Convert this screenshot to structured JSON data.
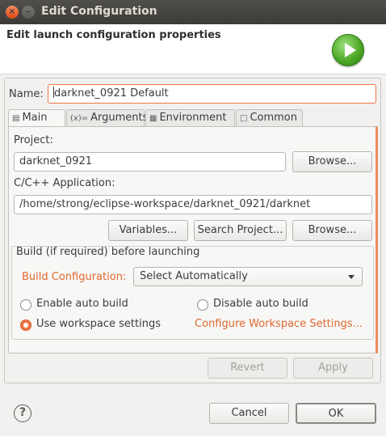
{
  "window": {
    "title": "Edit Configuration",
    "close_glyph": "×",
    "minimize_glyph": "–"
  },
  "header": {
    "title": "Edit launch configuration properties",
    "icon": "run-launch-icon"
  },
  "name": {
    "label": "Name:",
    "value": "darknet_0921 Default"
  },
  "tabs": [
    {
      "label": "Main",
      "icon": "main-tab-icon"
    },
    {
      "label": "Arguments",
      "icon": "arguments-tab-icon"
    },
    {
      "label": "Environment",
      "icon": "environment-tab-icon"
    },
    {
      "label": "Common",
      "icon": "common-tab-icon"
    }
  ],
  "project": {
    "label": "Project:",
    "value": "darknet_0921",
    "browse_label": "Browse..."
  },
  "application": {
    "label": "C/C++ Application:",
    "value": "/home/strong/eclipse-workspace/darknet_0921/darknet",
    "variables_label": "Variables...",
    "search_label": "Search Project...",
    "browse_label": "Browse..."
  },
  "build": {
    "group_label": "Build (if required) before launching",
    "config_label": "Build Configuration:",
    "config_value": "Select Automatically",
    "enable_auto": "Enable auto build",
    "disable_auto": "Disable auto build",
    "use_workspace": "Use workspace settings",
    "configure_link": "Configure Workspace Settings...",
    "selected": "use_workspace"
  },
  "actions": {
    "revert": "Revert",
    "apply": "Apply",
    "cancel": "Cancel",
    "ok": "OK",
    "help": "?"
  },
  "colors": {
    "accent": "#f07746",
    "link": "#e0672c",
    "titlebar": "#3c3b37"
  }
}
